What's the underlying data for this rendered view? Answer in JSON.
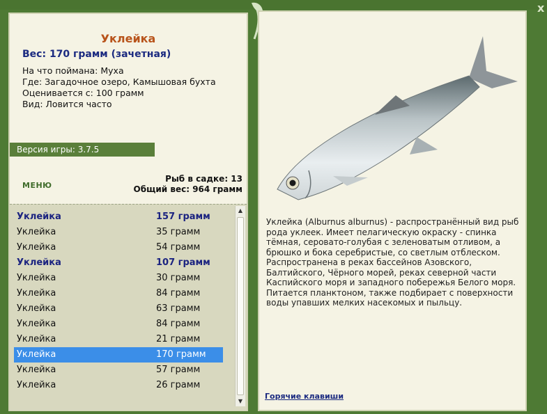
{
  "left": {
    "title": "Уклейка",
    "weight": "Вес: 170 грамм (зачетная)",
    "info": [
      "На что поймана: Муха",
      "Где: Загадочное озеро, Камышовая бухта",
      "Оценивается с: 100 грамм",
      "Вид: Ловится часто"
    ],
    "version": "Версия игры: 3.7.5",
    "menu_label": "МЕНЮ",
    "stats": {
      "count": "Рыб в садке: 13",
      "total": "Общий вес: 964 грамм"
    },
    "list": [
      {
        "name": "Уклейка",
        "weight": "157 грамм",
        "style": "bold"
      },
      {
        "name": "Уклейка",
        "weight": "35 грамм",
        "style": ""
      },
      {
        "name": "Уклейка",
        "weight": "54 грамм",
        "style": ""
      },
      {
        "name": "Уклейка",
        "weight": "107 грамм",
        "style": "bold"
      },
      {
        "name": "Уклейка",
        "weight": "30 грамм",
        "style": ""
      },
      {
        "name": "Уклейка",
        "weight": "84 грамм",
        "style": ""
      },
      {
        "name": "Уклейка",
        "weight": "63 грамм",
        "style": ""
      },
      {
        "name": "Уклейка",
        "weight": "84 грамм",
        "style": ""
      },
      {
        "name": "Уклейка",
        "weight": "21 грамм",
        "style": ""
      },
      {
        "name": "Уклейка",
        "weight": "170 грамм",
        "style": "selected"
      },
      {
        "name": "Уклейка",
        "weight": "57 грамм",
        "style": ""
      },
      {
        "name": "Уклейка",
        "weight": "26 грамм",
        "style": ""
      }
    ]
  },
  "right": {
    "description": "Уклейка (Alburnus alburnus) - распространённый вид рыб рода уклеек. Имеет пелагическую окраску - спинка тёмная, серовато-голубая с зеленоватым отливом, а брюшко и бока серебристые, со светлым отблеском. Распространена в реках бассейнов Азовского, Балтийского, Чёрного морей, реках северной части Каспийского моря и западного побережья Белого моря. Питается планктоном, также подбирает с поверхности воды упавших мелких насекомых и пыльцу.",
    "hotkeys": "Горячие клавиши"
  },
  "close_label": "x",
  "icons": {
    "fish": "fish-image",
    "leaf": "leaf-decoration-icon",
    "scroll_up": "scroll-up-arrow-icon",
    "scroll_down": "scroll-down-arrow-icon"
  },
  "colors": {
    "frame": "#4e7a34",
    "panel": "#f5f3e4",
    "title": "#b8531a",
    "accent_text": "#1b2a80",
    "selected_row": "#3b8ee8",
    "version_bar": "#5a7f3a"
  }
}
